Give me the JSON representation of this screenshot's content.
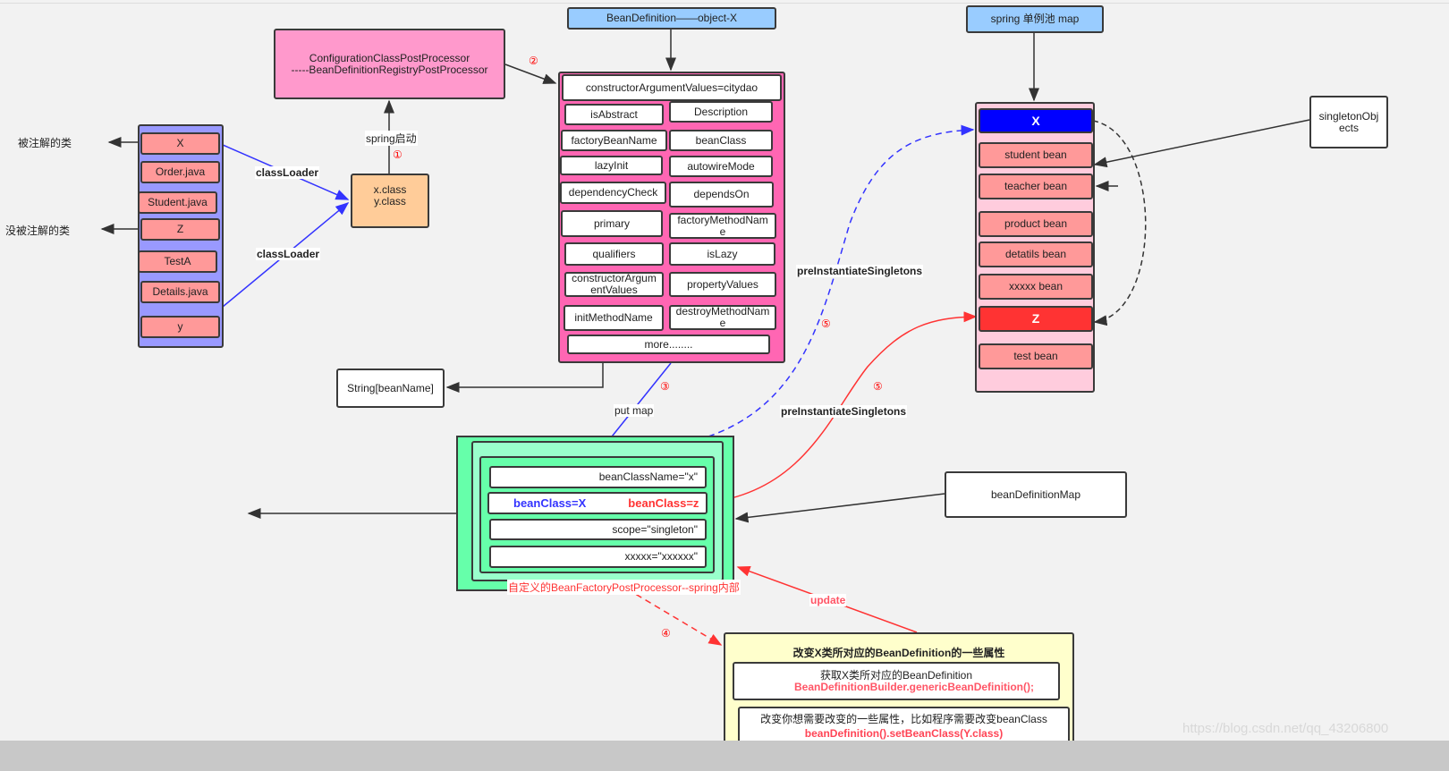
{
  "colors": {
    "background": "#f2f2f2",
    "config_processor": "#ff99cc",
    "class_list": "#9999ff",
    "class_item": "#ff9999",
    "class_files": "#ffcc99",
    "header_blue": "#99ccff",
    "bean_def": "#ff66b3",
    "singleton_pool": "#ffccdd",
    "bean_x": "#0000ff",
    "bean_z": "#ff3333",
    "bdmap": "#66ffaa",
    "yellow": "#ffffcc"
  },
  "config_processor": {
    "line1": "ConfigurationClassPostProcessor",
    "line2": "-----BeanDefinitionRegistryPostProcessor"
  },
  "classes": [
    "X",
    "Order.java",
    "Student.java",
    "Z",
    "TestA",
    "Details.java",
    "y"
  ],
  "annotated_label": "被注解的类",
  "not_annotated_label": "没被注解的类",
  "class_loader_label": "classLoader",
  "class_files": {
    "line1": "x.class",
    "line2": "y.class"
  },
  "spring_start_label": "spring启动",
  "steps": {
    "s1": "①",
    "s2": "②",
    "s3": "③",
    "s4": "④",
    "s5": "⑤"
  },
  "bean_definition_header": "BeanDefinition——object-X",
  "bean_definition_fields": {
    "constructor": "constructorArgumentValues=citydao",
    "cells": [
      "isAbstract",
      "Description",
      "factoryBeanName",
      "beanClass",
      "lazyInit",
      "autowireMode",
      "dependencyCheck",
      "dependsOn",
      "primary",
      "factoryMethodName",
      "qualifiers",
      "isLazy",
      "constructorArgumentValues",
      "propertyValues",
      "initMethodName",
      "destroyMethodName"
    ],
    "more": "more........"
  },
  "string_bean_name": "String[beanName]",
  "put_map_label": "put map",
  "pool_header": "spring 单例池 map",
  "pool_items": [
    "X",
    "student bean",
    "teacher bean",
    "product bean",
    "detatils bean",
    "xxxxx bean",
    "Z",
    "test bean"
  ],
  "singleton_objects": "singletonObjects",
  "pre_instantiate_label": "preInstantiateSingletons",
  "bean_definition_map": "beanDefinitionMap",
  "bdmap_rows": {
    "class_name": "beanClassName=\"x\"",
    "bean_class_x": "beanClass=X",
    "bean_class_z": "beanClass=z",
    "scope": "scope=\"singleton\"",
    "other": "xxxxx=\"xxxxxx\""
  },
  "custom_processor_label": "自定义的BeanFactoryPostProcessor--spring内部",
  "update_label": "update",
  "modify_box": {
    "title": "改变X类所对应的BeanDefinition的一些属性",
    "get_text": "获取X类所对应的BeanDefinition",
    "get_code": "BeanDefinitionBuilder.genericBeanDefinition();",
    "change_text": "改变你想需要改变的一些属性，比如程序需要改变beanClass",
    "change_code": "beanDefinition().setBeanClass(Y.class)"
  },
  "watermark": "https://blog.csdn.net/qq_43206800"
}
